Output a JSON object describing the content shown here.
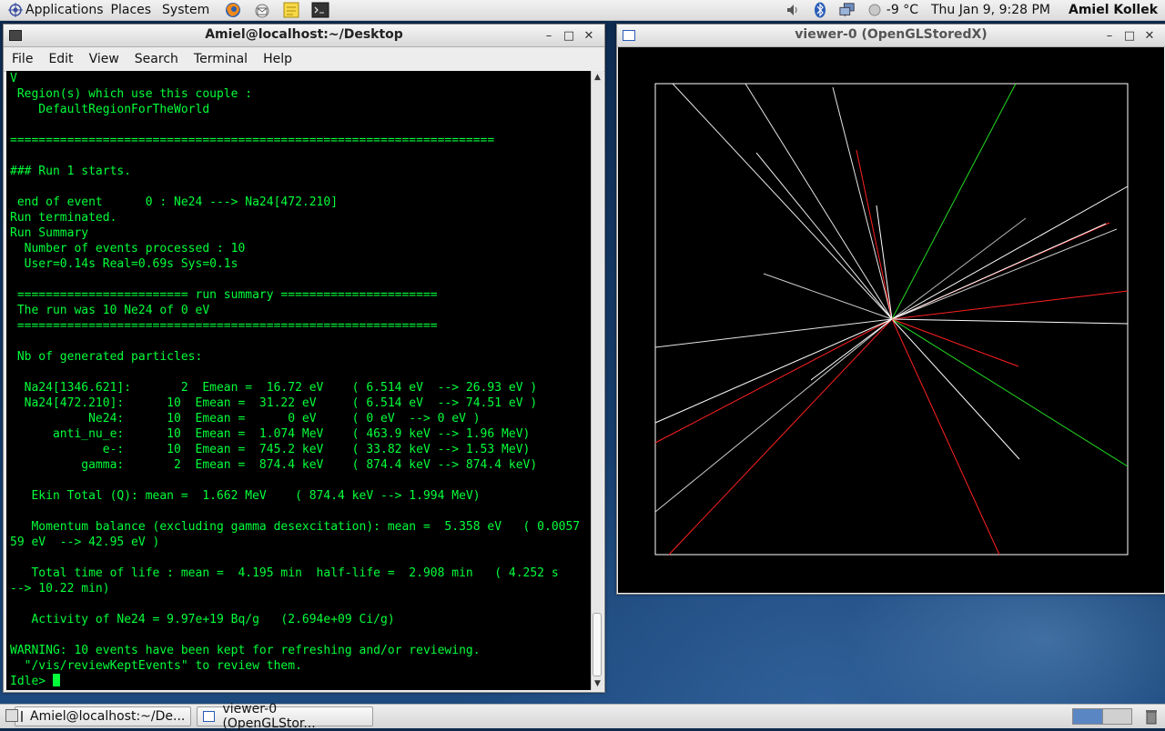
{
  "top_panel": {
    "menus": [
      "Applications",
      "Places",
      "System"
    ],
    "launchers": [
      "firefox-icon",
      "email-icon",
      "notes-icon",
      "terminal-icon"
    ],
    "tray": [
      "volume-icon",
      "bluetooth-icon",
      "network-icon"
    ],
    "weather": "-9 °C",
    "clock": "Thu Jan  9,  9:28 PM",
    "user": "Amiel Kollek"
  },
  "terminal": {
    "title": "Amiel@localhost:~/Desktop",
    "menu": [
      "File",
      "Edit",
      "View",
      "Search",
      "Terminal",
      "Help"
    ],
    "lines": [
      "V",
      " Region(s) which use this couple : ",
      "    DefaultRegionForTheWorld",
      "",
      "====================================================================",
      "",
      "### Run 1 starts.",
      "",
      " end of event      0 : Ne24 ---> Na24[472.210]",
      "Run terminated.",
      "Run Summary",
      "  Number of events processed : 10",
      "  User=0.14s Real=0.69s Sys=0.1s",
      "",
      " ======================== run summary ======================",
      " The run was 10 Ne24 of 0 eV",
      " ===========================================================",
      "",
      " Nb of generated particles: ",
      "",
      "  Na24[1346.621]:       2  Emean =  16.72 eV    ( 6.514 eV  --> 26.93 eV )",
      "  Na24[472.210]:      10  Emean =  31.22 eV     ( 6.514 eV  --> 74.51 eV )",
      "           Ne24:      10  Emean =      0 eV     ( 0 eV  --> 0 eV )",
      "      anti_nu_e:      10  Emean =  1.074 MeV    ( 463.9 keV --> 1.96 MeV)",
      "             e-:      10  Emean =  745.2 keV    ( 33.82 keV --> 1.53 MeV)",
      "          gamma:       2  Emean =  874.4 keV    ( 874.4 keV --> 874.4 keV)",
      "",
      "   Ekin Total (Q): mean =  1.662 MeV    ( 874.4 keV --> 1.994 MeV)",
      "",
      "   Momentum balance (excluding gamma desexcitation): mean =  5.358 eV   ( 0.0057",
      "59 eV  --> 42.95 eV )",
      "",
      "   Total time of life : mean =  4.195 min  half-life =  2.908 min   ( 4.252 s",
      "--> 10.22 min)",
      "",
      "   Activity of Ne24 = 9.97e+19 Bq/g   (2.694e+09 Ci/g)",
      "",
      "WARNING: 10 events have been kept for refreshing and/or reviewing.",
      "  \"/vis/reviewKeptEvents\" to review them.",
      "Idle> "
    ]
  },
  "viewer": {
    "title": "viewer-0 (OpenGLStoredX)",
    "track_colors": {
      "charged_negative": "#ff2020",
      "neutral": "#22dd22",
      "other": "#ffffff"
    }
  },
  "taskbar": {
    "tasks": [
      "Amiel@localhost:~/De...",
      "viewer-0 (OpenGLStor..."
    ]
  }
}
